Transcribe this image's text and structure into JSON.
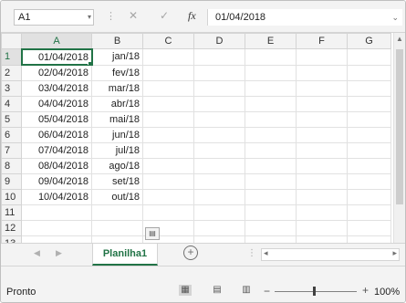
{
  "formula_bar": {
    "name_box": "A1",
    "fx_label": "fx",
    "formula_value": "01/04/2018"
  },
  "columns": [
    "A",
    "B",
    "C",
    "D",
    "E",
    "F",
    "G"
  ],
  "rows": [
    {
      "num": "1",
      "a": "01/04/2018",
      "b": "jan/18"
    },
    {
      "num": "2",
      "a": "02/04/2018",
      "b": "fev/18"
    },
    {
      "num": "3",
      "a": "03/04/2018",
      "b": "mar/18"
    },
    {
      "num": "4",
      "a": "04/04/2018",
      "b": "abr/18"
    },
    {
      "num": "5",
      "a": "05/04/2018",
      "b": "mai/18"
    },
    {
      "num": "6",
      "a": "06/04/2018",
      "b": "jun/18"
    },
    {
      "num": "7",
      "a": "07/04/2018",
      "b": "jul/18"
    },
    {
      "num": "8",
      "a": "08/04/2018",
      "b": "ago/18"
    },
    {
      "num": "9",
      "a": "09/04/2018",
      "b": "set/18"
    },
    {
      "num": "10",
      "a": "10/04/2018",
      "b": "out/18"
    },
    {
      "num": "11",
      "a": "",
      "b": ""
    },
    {
      "num": "12",
      "a": "",
      "b": ""
    },
    {
      "num": "13",
      "a": "",
      "b": ""
    }
  ],
  "sheet_tab": "Planilha1",
  "status": {
    "text": "Pronto",
    "zoom": "100%"
  },
  "colors": {
    "accent": "#217346",
    "header_bg": "#f3f3f3",
    "gridline": "#e1e1e1"
  }
}
